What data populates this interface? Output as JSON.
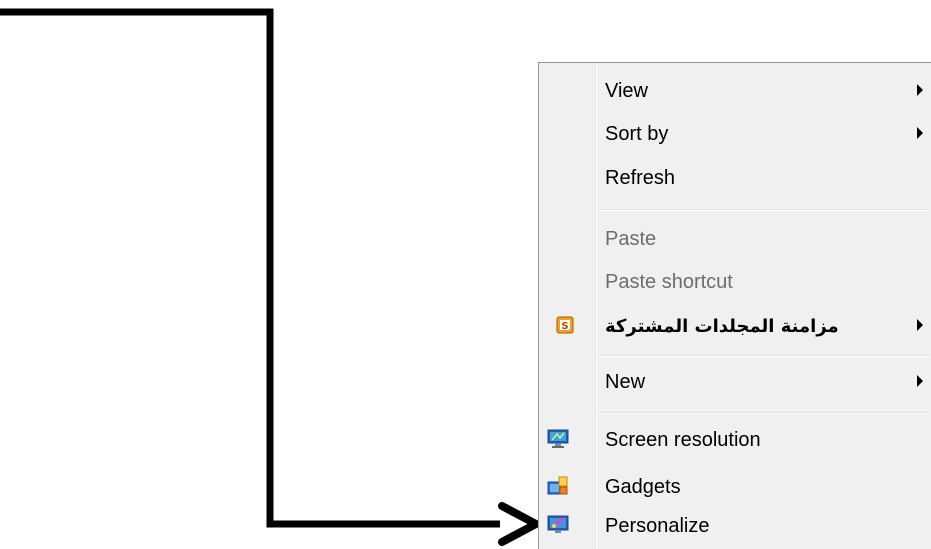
{
  "annotation": {
    "arrow_color": "#000000"
  },
  "menu": {
    "background": "#f0f0f0",
    "items": [
      {
        "label": "View",
        "has_submenu": true,
        "enabled": true
      },
      {
        "label": "Sort by",
        "has_submenu": true,
        "enabled": true
      },
      {
        "label": "Refresh",
        "has_submenu": false,
        "enabled": true
      },
      {
        "label": "Paste",
        "has_submenu": false,
        "enabled": false
      },
      {
        "label": "Paste shortcut",
        "has_submenu": false,
        "enabled": false
      },
      {
        "label": "مزامنة المجلدات المشتركة",
        "has_submenu": true,
        "enabled": true,
        "icon": "shared-folder-sync-icon"
      },
      {
        "label": "New",
        "has_submenu": true,
        "enabled": true
      },
      {
        "label": "Screen resolution",
        "has_submenu": false,
        "enabled": true,
        "icon": "monitor-icon"
      },
      {
        "label": "Gadgets",
        "has_submenu": false,
        "enabled": true,
        "icon": "gadgets-icon"
      },
      {
        "label": "Personalize",
        "has_submenu": false,
        "enabled": true,
        "icon": "personalize-icon"
      }
    ]
  }
}
